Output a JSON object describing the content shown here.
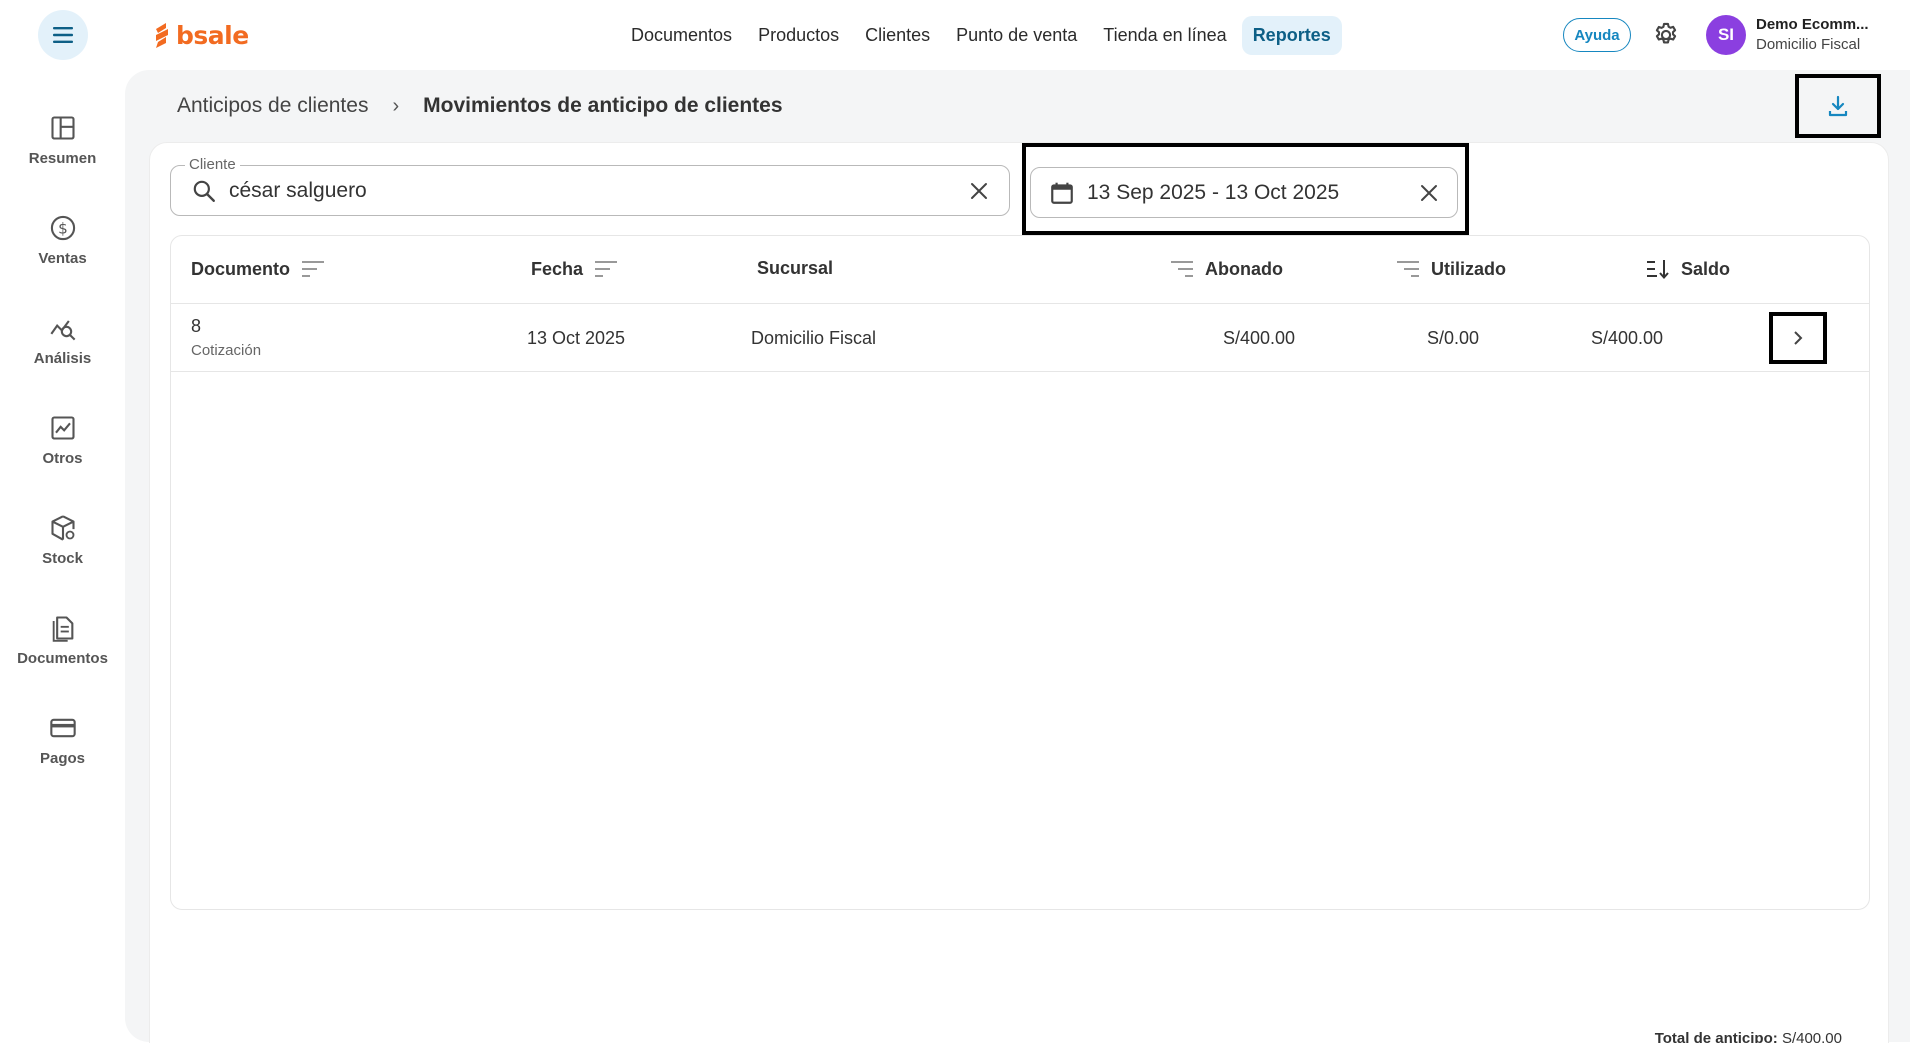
{
  "brand": {
    "logo_text": "bsale",
    "accent": "#f26b21"
  },
  "nav": {
    "items": [
      {
        "label": "Documentos",
        "active": false
      },
      {
        "label": "Productos",
        "active": false
      },
      {
        "label": "Clientes",
        "active": false
      },
      {
        "label": "Punto de venta",
        "active": false
      },
      {
        "label": "Tienda en línea",
        "active": false
      },
      {
        "label": "Reportes",
        "active": true
      }
    ]
  },
  "header": {
    "help_label": "Ayuda",
    "avatar_initials": "SI",
    "account_name": "Demo Ecomm...",
    "account_branch": "Domicilio Fiscal"
  },
  "sidebar": {
    "items": [
      {
        "label": "Resumen",
        "icon": "dashboard-icon"
      },
      {
        "label": "Ventas",
        "icon": "dollar-icon"
      },
      {
        "label": "Análisis",
        "icon": "analytics-icon"
      },
      {
        "label": "Otros",
        "icon": "chart-icon"
      },
      {
        "label": "Stock",
        "icon": "box-icon"
      },
      {
        "label": "Documentos",
        "icon": "document-icon"
      },
      {
        "label": "Pagos",
        "icon": "card-icon"
      }
    ]
  },
  "breadcrumb": {
    "parent": "Anticipos de clientes",
    "separator": "›",
    "current": "Movimientos de anticipo de clientes"
  },
  "filters": {
    "client_label": "Cliente",
    "client_value": "césar salguero",
    "date_range": "13 Sep 2025 - 13 Oct 2025"
  },
  "table": {
    "headers": [
      "Documento",
      "Fecha",
      "Sucursal",
      "Abonado",
      "Utilizado",
      "Saldo"
    ],
    "rows": [
      {
        "doc_number": "8",
        "doc_type": "Cotización",
        "fecha": "13 Oct 2025",
        "sucursal": "Domicilio Fiscal",
        "abonado": "S/400.00",
        "utilizado": "S/0.00",
        "saldo": "S/400.00"
      }
    ]
  },
  "footer": {
    "total_label": "Total de anticipo:",
    "total_value": "S/400.00"
  }
}
